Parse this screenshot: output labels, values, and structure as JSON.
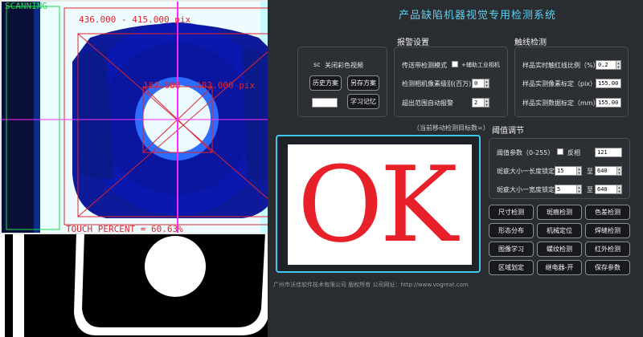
{
  "app": {
    "title": "产品缺陷机器视觉专用检测系统"
  },
  "camera": {
    "scanning_label": "SCANNING",
    "outer_coords": "436.000 - 415.000 pix",
    "inner_coords": "183.000 - 183.000 pix",
    "touch_label": "TOUCH PERCENT = 60.63%"
  },
  "left_group": {
    "truncated_text": "sc",
    "close_video_label": "关闭彩色视频",
    "history_button": "历史方案",
    "save_button": "另存方案",
    "learn_button": "学习记忆"
  },
  "alarm": {
    "title": "报警设置",
    "conveyor_mode_label": "传送带检测模式",
    "aux_camera_label": "+辅助工业相机",
    "camera_pixels_label": "检测相机像素级别(百万)",
    "camera_pixels_value": "0",
    "auto_alarm_label": "超出范围自动报警",
    "auto_alarm_value": "2"
  },
  "trigger": {
    "title": "触线检测",
    "ratio_label": "样品实时触红线比例（%）",
    "ratio_value": "0.2",
    "pix_label": "样品实测像素标定（pix）",
    "pix_value": "155.00",
    "mm_label": "样品实测数据标定（mm）",
    "mm_value": "155.00"
  },
  "ok_display": {
    "hint": "（当前移动检测目标数=）",
    "result": "OK"
  },
  "threshold": {
    "title": "阈值调节",
    "param_label": "阈值参数（0-255）",
    "invert_label": "反相",
    "param_value": "121",
    "length_label": "斑疵大小一长度锁定",
    "length_min": "15",
    "length_max": "640",
    "width_label": "斑疵大小一宽度锁定",
    "width_min": "5",
    "width_max": "640",
    "to_label": "至"
  },
  "detect_buttons": [
    "尺寸检测",
    "斑痕检测",
    "色差检测",
    "形态分布",
    "机械定位",
    "焊缝检测",
    "图像学习",
    "螺纹检测",
    "红外检测",
    "区域划定",
    "继电器-开",
    "保存参数"
  ],
  "footer": "广州市沃佳软件技术有限公司  版权所有  公司网址：http://www.vogreat.com",
  "colors": {
    "accent": "#5fd0f0",
    "ok_red": "#e8202a",
    "overlay_red": "#e0242c",
    "scan_green": "#22d84a",
    "magenta_line": "#ff29ff",
    "part_blue": "#1028c8"
  }
}
